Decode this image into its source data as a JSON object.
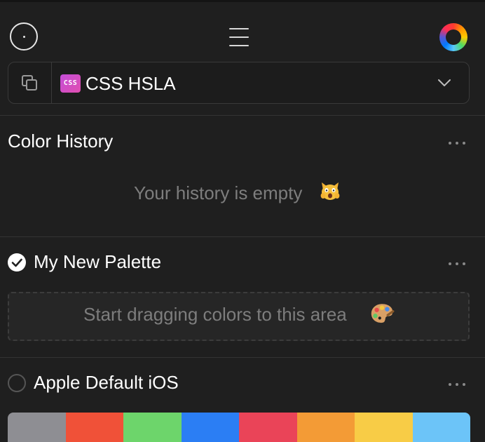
{
  "toolbar": {
    "picker_icon": "eyedropper-target-icon",
    "menu_icon": "hamburger-menu-icon",
    "wheel_icon": "color-wheel-icon"
  },
  "format": {
    "copy_icon": "copy-icon",
    "badge": "CSS",
    "label": "CSS HSLA",
    "chevron_icon": "chevron-down-icon"
  },
  "history": {
    "title": "Color History",
    "empty_text": "Your history is empty",
    "empty_emoji": "scared-cat-emoji-icon"
  },
  "palettes": [
    {
      "name": "My New Palette",
      "selected": true,
      "drop_text": "Start dragging colors to this area",
      "drop_emoji": "artist-palette-emoji-icon"
    },
    {
      "name": "Apple Default iOS",
      "selected": false,
      "colors": [
        "#8e8e93",
        "#f05138",
        "#6dd56b",
        "#2b7ef4",
        "#ea4458",
        "#f39b36",
        "#f8cc46",
        "#6cc4f8"
      ]
    }
  ]
}
